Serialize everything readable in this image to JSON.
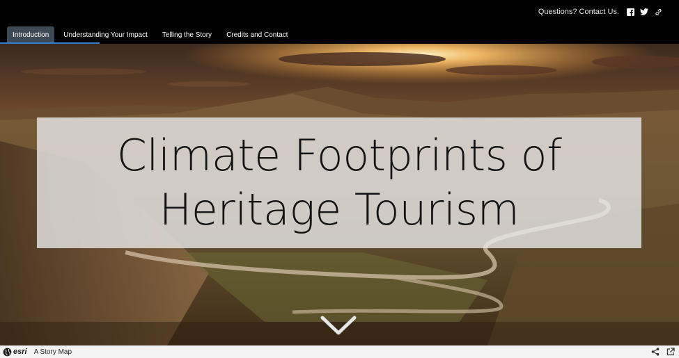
{
  "header": {
    "contact_text": "Questions? Contact Us.",
    "social_icons": [
      "facebook-icon",
      "twitter-icon",
      "link-icon"
    ],
    "tabs": [
      {
        "label": "Introduction",
        "active": true
      },
      {
        "label": "Understanding Your Impact",
        "active": false
      },
      {
        "label": "Telling the Story",
        "active": false
      },
      {
        "label": "Credits and Contact",
        "active": false
      }
    ],
    "accent_color": "#2e7fd1"
  },
  "hero": {
    "title_line1": "Climate Footprints of",
    "title_line2": "Heritage Tourism",
    "scroll_icon": "chevron-down-icon"
  },
  "footer": {
    "brand": "esri",
    "label": "A Story Map",
    "icons": [
      "share-icon",
      "open-external-icon"
    ]
  }
}
